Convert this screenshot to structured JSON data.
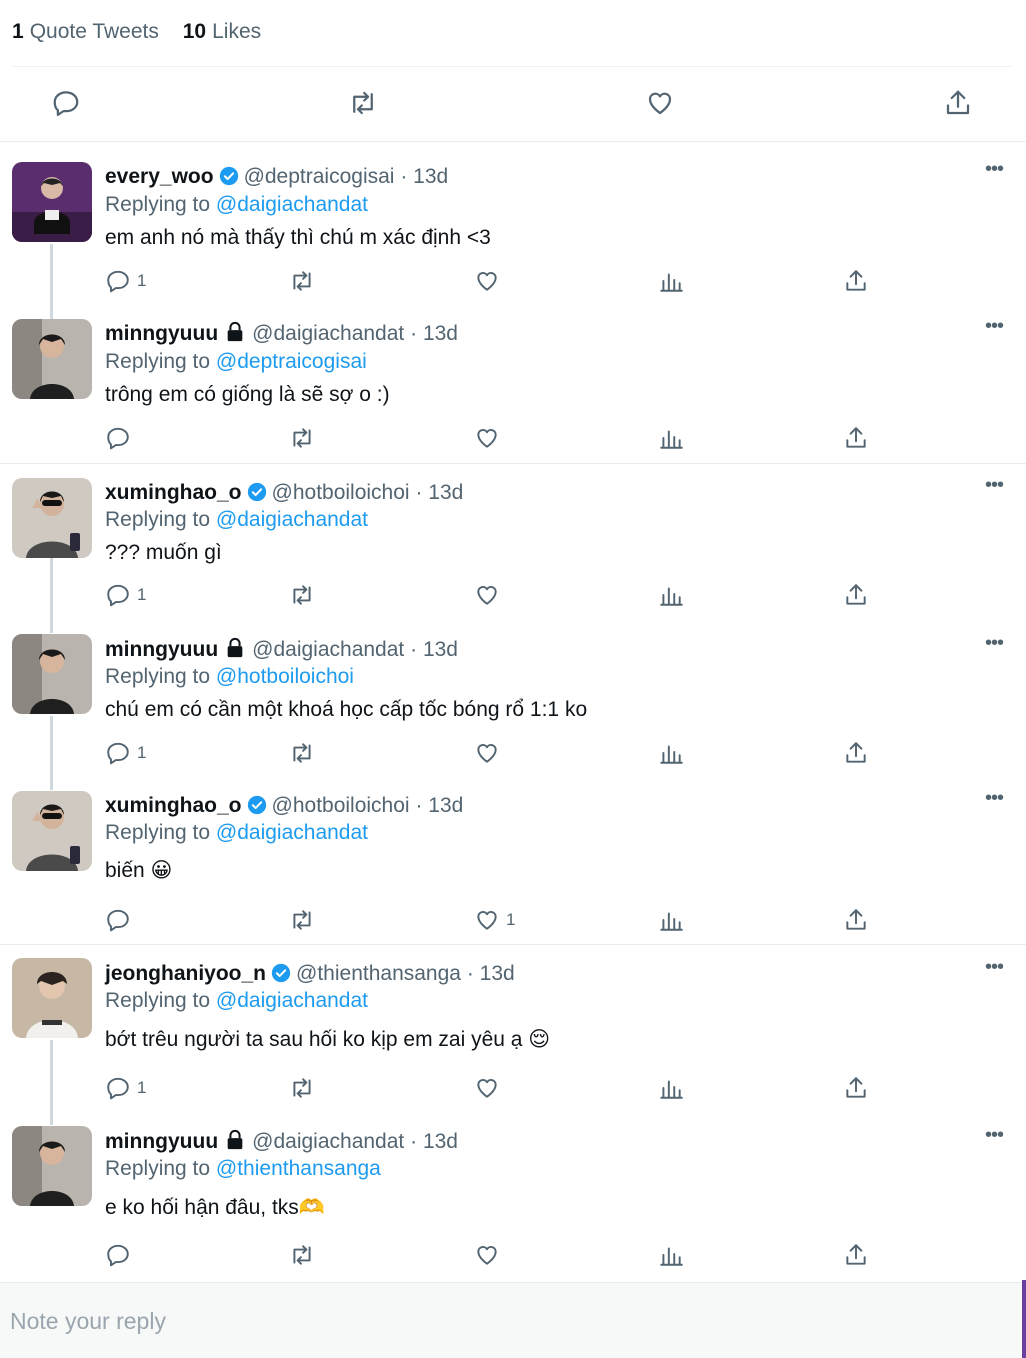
{
  "stats": {
    "quote_tweets_count": "1",
    "quote_tweets_label": "Quote Tweets",
    "likes_count": "10",
    "likes_label": "Likes"
  },
  "action_bar": [
    "reply-icon",
    "retweet-icon",
    "like-icon",
    "share-icon"
  ],
  "tweets": [
    {
      "name": "every_woo",
      "verified": true,
      "handle": "@deptraicogisai",
      "dot": "·",
      "time": "13d",
      "replying_prefix": "Replying to",
      "replying_to": "@daigiachandat",
      "text": "em anh nó mà thấy thì chú m xác định <3",
      "reply_count": "1",
      "retweet_count": "",
      "like_count": ""
    },
    {
      "name": "minngyuuu",
      "verified": false,
      "protected": true,
      "handle": "@daigiachandat",
      "dot": "·",
      "time": "13d",
      "replying_prefix": "Replying to",
      "replying_to": "@deptraicogisai",
      "text": "trông em có giống là sẽ sợ o :)",
      "reply_count": "",
      "retweet_count": "",
      "like_count": ""
    },
    {
      "name": "xuminghao_o",
      "verified": true,
      "handle": "@hotboiloichoi",
      "dot": "·",
      "time": "13d",
      "replying_prefix": "Replying to",
      "replying_to": "@daigiachandat",
      "text": "??? muốn gì",
      "reply_count": "1",
      "retweet_count": "",
      "like_count": ""
    },
    {
      "name": "minngyuuu",
      "verified": false,
      "protected": true,
      "handle": "@daigiachandat",
      "dot": "·",
      "time": "13d",
      "replying_prefix": "Replying to",
      "replying_to": "@hotboiloichoi",
      "text": "chú em có cần một khoá học cấp tốc bóng rổ 1:1 ko",
      "reply_count": "1",
      "retweet_count": "",
      "like_count": ""
    },
    {
      "name": "xuminghao_o",
      "verified": true,
      "handle": "@hotboiloichoi",
      "dot": "·",
      "time": "13d",
      "replying_prefix": "Replying to",
      "replying_to": "@daigiachandat",
      "text": "biến 😀",
      "reply_count": "",
      "retweet_count": "",
      "like_count": "1"
    },
    {
      "name": "jeonghaniyoo_n",
      "verified": true,
      "handle": "@thienthansanga",
      "dot": "·",
      "time": "13d",
      "replying_prefix": "Replying to",
      "replying_to": "@daigiachandat",
      "text": "bớt trêu người ta sau hối ko kịp em zai yêu ạ 😌",
      "reply_count": "1",
      "retweet_count": "",
      "like_count": ""
    },
    {
      "name": "minngyuuu",
      "verified": false,
      "protected": true,
      "handle": "@daigiachandat",
      "dot": "·",
      "time": "13d",
      "replying_prefix": "Replying to",
      "replying_to": "@thienthansanga",
      "text": "e ko hối hận đâu, tks🫶",
      "reply_count": "",
      "retweet_count": "",
      "like_count": ""
    }
  ],
  "reply_box": {
    "placeholder": "Note your reply"
  },
  "colors": {
    "accent": "#1d9bf0",
    "muted": "#536471",
    "text": "#0f1419",
    "divider": "#e6ecf0"
  }
}
